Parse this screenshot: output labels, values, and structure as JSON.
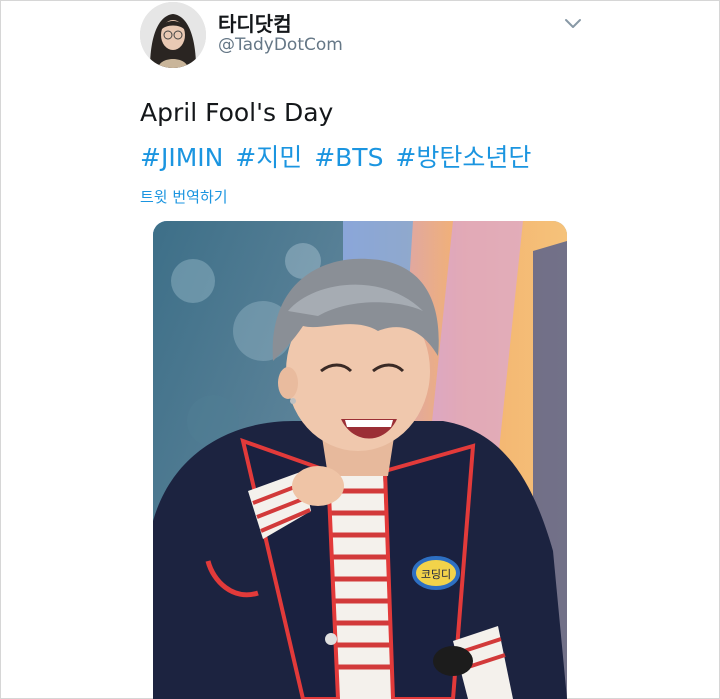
{
  "tweet": {
    "author": {
      "display_name": "타디닷컴",
      "handle": "@TadyDotCom",
      "avatar_icon": "profile-photo"
    },
    "menu_icon": "chevron-down-icon",
    "text": "April Fool's Day",
    "hashtags": [
      "#JIMIN",
      "#지민",
      "#BTS",
      "#방탄소년단"
    ],
    "translate_label": "트윗 번역하기",
    "media": {
      "type": "photo",
      "badge_text": "코딩디"
    }
  },
  "colors": {
    "link": "#1b95e0",
    "text": "#14171a",
    "secondary": "#657786"
  }
}
